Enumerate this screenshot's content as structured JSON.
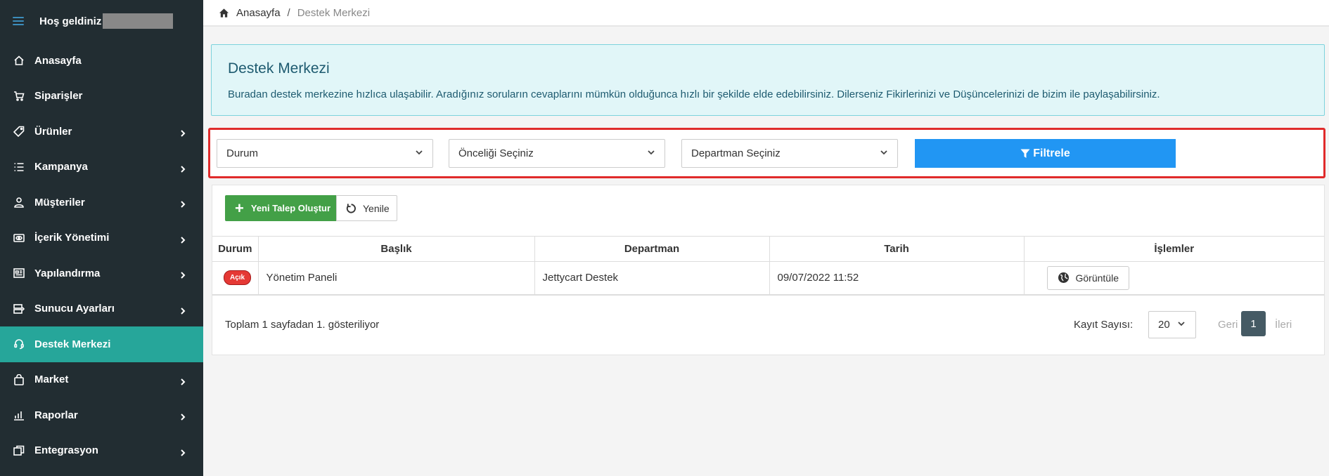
{
  "sidebar": {
    "welcome": "Hoş geldiniz",
    "items": [
      {
        "label": "Anasayfa",
        "icon": "home-icon"
      },
      {
        "label": "Siparişler",
        "icon": "cart-icon"
      },
      {
        "label": "Ürünler",
        "icon": "tag-icon"
      },
      {
        "label": "Kampanya",
        "icon": "list-icon"
      },
      {
        "label": "Müşteriler",
        "icon": "user-icon"
      },
      {
        "label": "İçerik Yönetimi",
        "icon": "eye-icon"
      },
      {
        "label": "Yapılandırma",
        "icon": "newspaper-icon"
      },
      {
        "label": "Sunucu Ayarları",
        "icon": "server-icon"
      },
      {
        "label": "Destek Merkezi",
        "icon": "headset-icon"
      },
      {
        "label": "Market",
        "icon": "bag-icon"
      },
      {
        "label": "Raporlar",
        "icon": "chart-icon"
      },
      {
        "label": "Entegrasyon",
        "icon": "layers-icon"
      }
    ]
  },
  "breadcrumb": {
    "home": "Anasayfa",
    "separator": "/",
    "current": "Destek Merkezi"
  },
  "info": {
    "title": "Destek Merkezi",
    "text": "Buradan destek merkezine hızlıca ulaşabilir. Aradığınız soruların cevaplarını mümkün olduğunca hızlı bir şekilde elde edebilirsiniz. Dilerseniz Fikirlerinizi ve Düşüncelerinizi de bizim ile paylaşabilirsiniz."
  },
  "filters": {
    "status": "Durum",
    "priority": "Önceliği Seçiniz",
    "department": "Departman Seçiniz",
    "filter_button": "Filtrele"
  },
  "actions": {
    "new_ticket": "Yeni Talep Oluştur",
    "refresh": "Yenile"
  },
  "table": {
    "headers": [
      "Durum",
      "Başlık",
      "Departman",
      "Tarih",
      "İşlemler"
    ],
    "rows": [
      {
        "status": "Açık",
        "title": "Yönetim Paneli",
        "department": "Jettycart Destek",
        "date": "09/07/2022 11:52",
        "action": "Görüntüle"
      }
    ]
  },
  "footer": {
    "summary": "Toplam 1 sayfadan 1. gösteriliyor",
    "records_label": "Kayıt Sayısı:",
    "records_value": "20",
    "prev": "Geri",
    "page": "1",
    "next": "İleri"
  },
  "colors": {
    "sidebar": "#222d32",
    "active": "#26a69a",
    "primary": "#2196f3",
    "success": "#43a047",
    "danger": "#e53935",
    "highlight": "#e02b2b"
  }
}
